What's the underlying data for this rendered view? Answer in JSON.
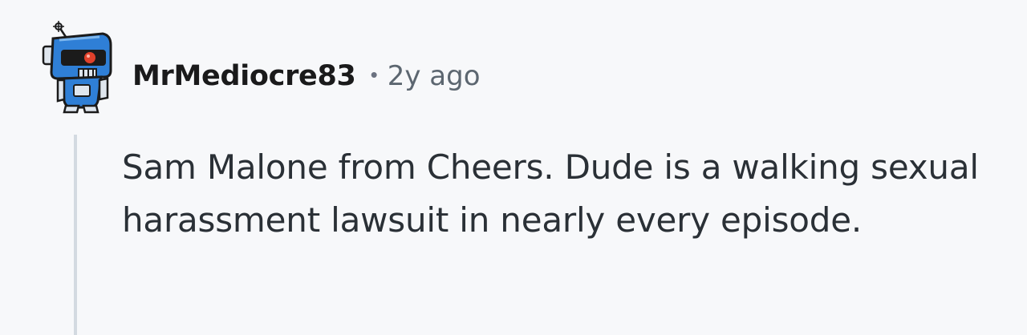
{
  "comment": {
    "username": "MrMediocre83",
    "separator": "•",
    "timestamp": "2y ago",
    "text": "Sam Malone from Cheers. Dude is a walking sexual harassment lawsuit in nearly every episode."
  },
  "avatar": {
    "icon": "robot-avatar-icon"
  },
  "colors": {
    "background": "#f7f8fa",
    "username": "#1a1a1b",
    "timestamp": "#5c6670",
    "body_text": "#2a3036",
    "thread_line": "#d3dae1",
    "avatar_blue": "#2f7fd6",
    "avatar_red": "#e0412b"
  }
}
